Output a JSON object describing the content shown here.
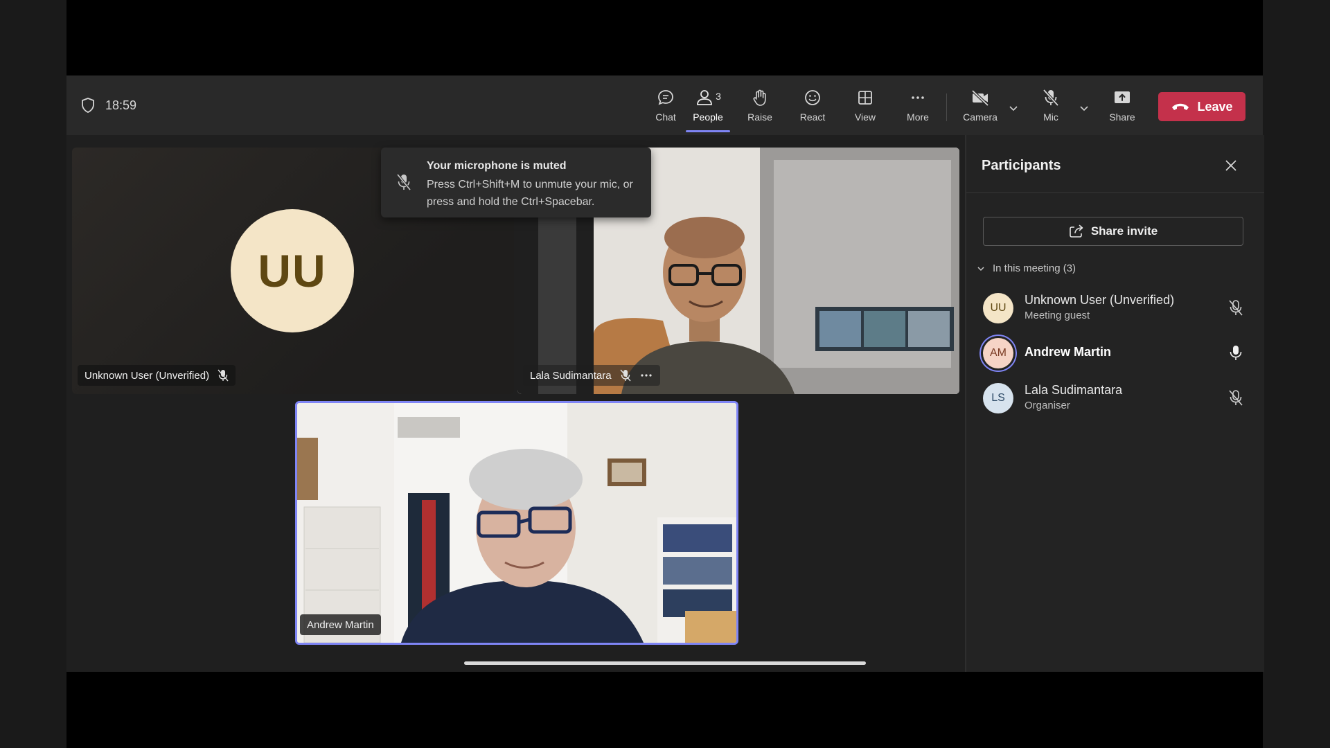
{
  "meeting": {
    "time": "18:59"
  },
  "toolbar": {
    "chat": "Chat",
    "people": "People",
    "people_count": "3",
    "raise": "Raise",
    "react": "React",
    "view": "View",
    "more": "More",
    "camera": "Camera",
    "mic": "Mic",
    "share": "Share",
    "leave": "Leave"
  },
  "stage": {
    "uu_initials": "UU",
    "uu_name": "Unknown User (Unverified)",
    "ls_name": "Lala Sudimantara",
    "am_name": "Andrew Martin"
  },
  "toast": {
    "title": "Your microphone is muted",
    "body": "Press Ctrl+Shift+M to unmute your mic, or press and hold the Ctrl+Spacebar."
  },
  "panel": {
    "title": "Participants",
    "share_invite": "Share invite",
    "section": "In this meeting (3)",
    "participants": [
      {
        "initials": "UU",
        "name": "Unknown User (Unverified)",
        "role": "Meeting guest",
        "mic": "muted"
      },
      {
        "initials": "AM",
        "name": "Andrew Martin",
        "role": "",
        "mic": "on"
      },
      {
        "initials": "LS",
        "name": "Lala Sudimantara",
        "role": "Organiser",
        "mic": "muted"
      }
    ]
  },
  "colors": {
    "accent": "#7f85f5",
    "leave": "#c4314b",
    "uu_avatar": "#f4e5c7",
    "am_avatar": "#f6d4c6",
    "ls_avatar": "#d7e3ee"
  }
}
